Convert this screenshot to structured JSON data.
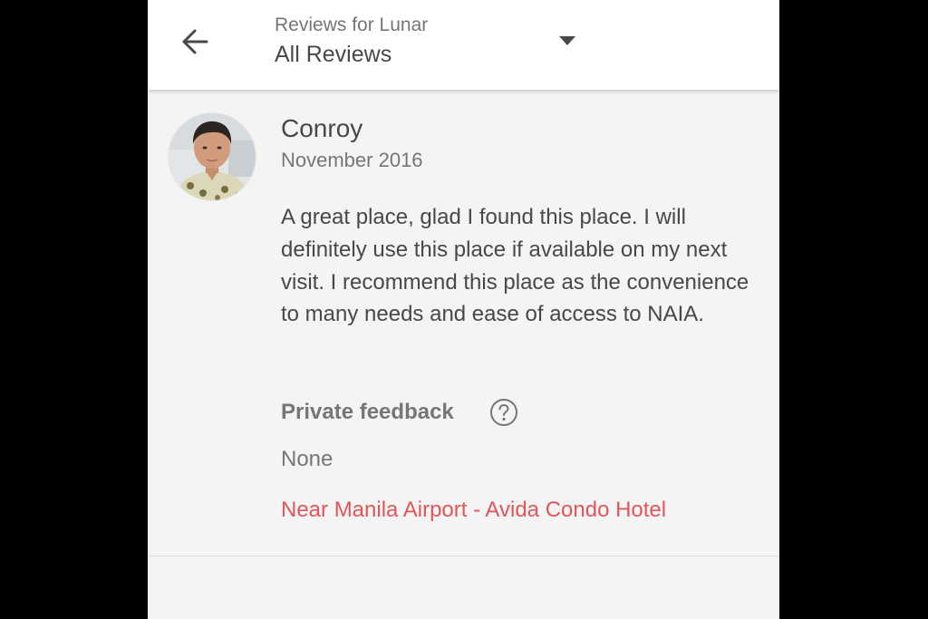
{
  "header": {
    "subtitle": "Reviews for Lunar",
    "title": "All Reviews",
    "back_icon": "arrow-left-icon",
    "dropdown_icon": "caret-down-icon"
  },
  "review": {
    "reviewer_name": "Conroy",
    "date": "November 2016",
    "text": "A great place, glad I found this place. I will definitely use this place if available on my next visit. I recommend this place as the convenience to many needs and ease of access to NAIA.",
    "private_feedback_label": "Private feedback",
    "help_icon": "question-circle-icon",
    "private_feedback_value": "None",
    "listing_name": "Near Manila Airport - Avida Condo Hotel"
  },
  "colors": {
    "background": "#f4f4f4",
    "header_background": "#ffffff",
    "text_primary": "#484848",
    "text_secondary": "#767676",
    "link": "#e0565b"
  }
}
